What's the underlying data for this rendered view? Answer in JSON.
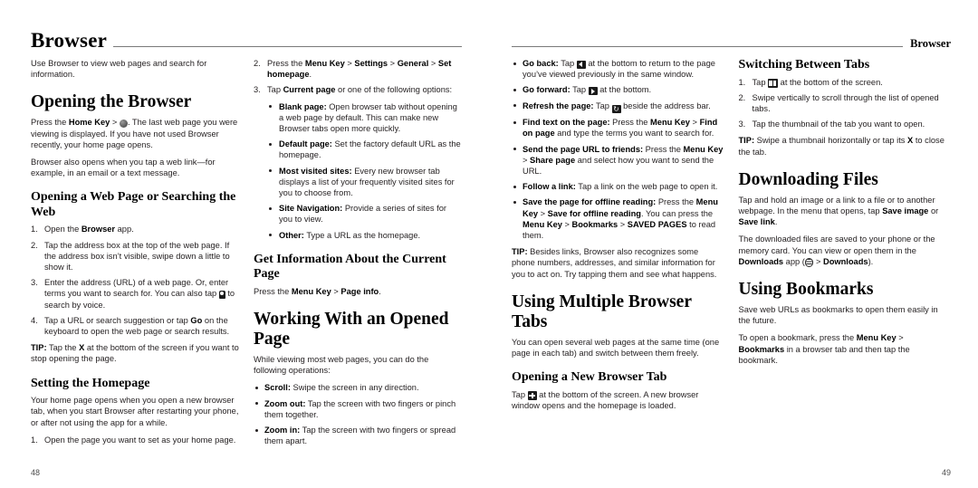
{
  "document": {
    "section_title": "Browser",
    "running_head": "Browser",
    "page_left_number": "48",
    "page_right_number": "49"
  },
  "icons": {
    "globe": "globe-icon",
    "mic": "microphone-icon",
    "back": "back-arrow-icon",
    "forward": "forward-arrow-icon",
    "refresh": "refresh-icon",
    "tabs": "tabs-icon",
    "plus": "plus-icon",
    "apps": "apps-grid-icon"
  },
  "col1": {
    "intro": "Use Browser to view web pages and search for information.",
    "h_opening_browser": "Opening the Browser",
    "p_press_home_pre": "Press the ",
    "p_press_home_b1": "Home Key",
    "p_press_home_mid": " > ",
    "p_press_home_post": ". The last web page you were viewing is displayed. If you have not used Browser recently, your home page opens.",
    "p_also_opens": "Browser also opens when you tap a web link—for example, in an email or a text message.",
    "h_opening_webpage": "Opening a Web Page or Searching the Web",
    "step1_pre": "Open the ",
    "step1_b": "Browser",
    "step1_post": " app.",
    "step2": "Tap the address box at the top of the web page. If the address box isn’t visible, swipe down a little to show it.",
    "step3_pre": "Enter the address (URL) of a web page. Or, enter terms you want to search for. You can also tap ",
    "step3_post": " to search by voice.",
    "step4_pre": "Tap a URL or search suggestion or tap ",
    "step4_b": "Go",
    "step4_post": " on the keyboard to open the web page or search results.",
    "tip_label": "TIP:",
    "tip_pre": " Tap the ",
    "tip_b": "X",
    "tip_post": " at the bottom of the screen if you want to stop opening the page.",
    "h_setting_homepage": "Setting the Homepage",
    "p_homepage": "Your home page opens when you open a new browser tab, when you start Browser after restarting your phone, or after not using the app for a while.",
    "hp_step1": "Open the page you want to set as your home page."
  },
  "col2": {
    "hp_step2_pre": "Press the ",
    "hp_step2_b1": "Menu Key",
    "hp_step2_s1": " > ",
    "hp_step2_b2": "Settings",
    "hp_step2_s2": " > ",
    "hp_step2_b3": "General",
    "hp_step2_s3": " > ",
    "hp_step2_b4": "Set homepage",
    "hp_step2_end": ".",
    "hp_step3_pre": "Tap ",
    "hp_step3_b": "Current page",
    "hp_step3_post": " or one of the following options:",
    "opt_blank_b": "Blank page:",
    "opt_blank_t": " Open browser tab without opening a web page by default. This can make new Browser tabs open more quickly.",
    "opt_default_b": "Default page:",
    "opt_default_t": " Set the factory default URL as the homepage.",
    "opt_most_b": "Most visited sites:",
    "opt_most_t": " Every new browser tab displays a list of your frequently visited sites for you to choose from.",
    "opt_nav_b": "Site Navigation:",
    "opt_nav_t": " Provide a series of sites for you to view.",
    "opt_other_b": "Other:",
    "opt_other_t": " Type a URL as the homepage.",
    "h_get_info": "Get Information About the Current Page",
    "p_get_info_pre": "Press the ",
    "p_get_info_b1": "Menu Key",
    "p_get_info_s": " > ",
    "p_get_info_b2": "Page info",
    "p_get_info_end": ".",
    "h_working": "Working With an Opened Page",
    "p_working": "While viewing most web pages, you can do the following operations:",
    "op_scroll_b": "Scroll:",
    "op_scroll_t": " Swipe the screen in any direction.",
    "op_zoomout_b": "Zoom out:",
    "op_zoomout_t": " Tap the screen with two fingers or pinch them together.",
    "op_zoomin_b": "Zoom in:",
    "op_zoomin_t": " Tap the screen with two fingers or spread them apart."
  },
  "col3": {
    "op_back_b": "Go back:",
    "op_back_t1": " Tap ",
    "op_back_t2": " at the bottom to return to the page you’ve viewed previously in the same window.",
    "op_fwd_b": "Go forward:",
    "op_fwd_t1": " Tap ",
    "op_fwd_t2": " at the bottom.",
    "op_refresh_b": "Refresh the page:",
    "op_refresh_t1": " Tap ",
    "op_refresh_t2": " beside the address bar.",
    "op_find_b": "Find text on the page:",
    "op_find_t1": " Press the ",
    "op_find_b2": "Menu Key",
    "op_find_s": " > ",
    "op_find_b3": "Find on page",
    "op_find_t2": " and type the terms you want to search for.",
    "op_send_b": "Send the page URL to friends:",
    "op_send_t1": " Press the ",
    "op_send_b2": "Menu Key",
    "op_send_s": " > ",
    "op_send_b3": "Share page",
    "op_send_t2": " and select how you want to send the URL.",
    "op_follow_b": "Follow a link:",
    "op_follow_t": " Tap a link on the web page to open it.",
    "op_save_b": "Save the page for offline reading:",
    "op_save_t1": " Press the ",
    "op_save_b2": "Menu Key",
    "op_save_s1": " > ",
    "op_save_b3": "Save for offline reading",
    "op_save_t2": ". You can press the ",
    "op_save_b4": "Menu Key",
    "op_save_s2": " > ",
    "op_save_b5": "Bookmarks",
    "op_save_s3": " > ",
    "op_save_b6": "SAVED PAGES",
    "op_save_t3": " to read them.",
    "tip_label": "TIP:",
    "tip_text": " Besides links, Browser also recognizes some phone numbers, addresses, and similar information for you to act on. Try tapping them and see what happens.",
    "h_multiple_tabs": "Using Multiple Browser Tabs",
    "p_multiple_tabs": "You can open several web pages at the same time (one page in each tab) and switch between them freely.",
    "h_new_tab": "Opening a New Browser Tab",
    "p_new_tab_pre": "Tap ",
    "p_new_tab_post": " at the bottom of the screen. A new browser window opens and the homepage is loaded."
  },
  "col4": {
    "h_switching": "Switching Between Tabs",
    "sw_step1_pre": "Tap ",
    "sw_step1_post": " at the bottom of the screen.",
    "sw_step2": "Swipe vertically to scroll through the list of opened tabs.",
    "sw_step3": "Tap the thumbnail of the tab you want to open.",
    "tip_label": "TIP:",
    "tip_pre": " Swipe a thumbnail horizontally or tap its ",
    "tip_b": "X",
    "tip_post": " to close the tab.",
    "h_downloading": "Downloading Files",
    "p_dl_pre": "Tap and hold an image or a link to a file or to another webpage. In the menu that opens, tap ",
    "p_dl_b1": "Save image",
    "p_dl_mid": " or ",
    "p_dl_b2": "Save link",
    "p_dl_end": ".",
    "p_dl2_pre": "The downloaded files are saved to your phone or the memory card. You can view or open them in the ",
    "p_dl2_b1": "Downloads",
    "p_dl2_mid": " app (",
    "p_dl2_s": " > ",
    "p_dl2_b2": "Downloads",
    "p_dl2_end": ").",
    "h_bookmarks": "Using Bookmarks",
    "p_bm1": "Save web URLs as bookmarks to open them easily in the future.",
    "p_bm2_pre": "To open a bookmark, press the ",
    "p_bm2_b1": "Menu Key",
    "p_bm2_s": " > ",
    "p_bm2_b2": "Bookmarks",
    "p_bm2_post": " in a browser tab and then tap the bookmark."
  }
}
